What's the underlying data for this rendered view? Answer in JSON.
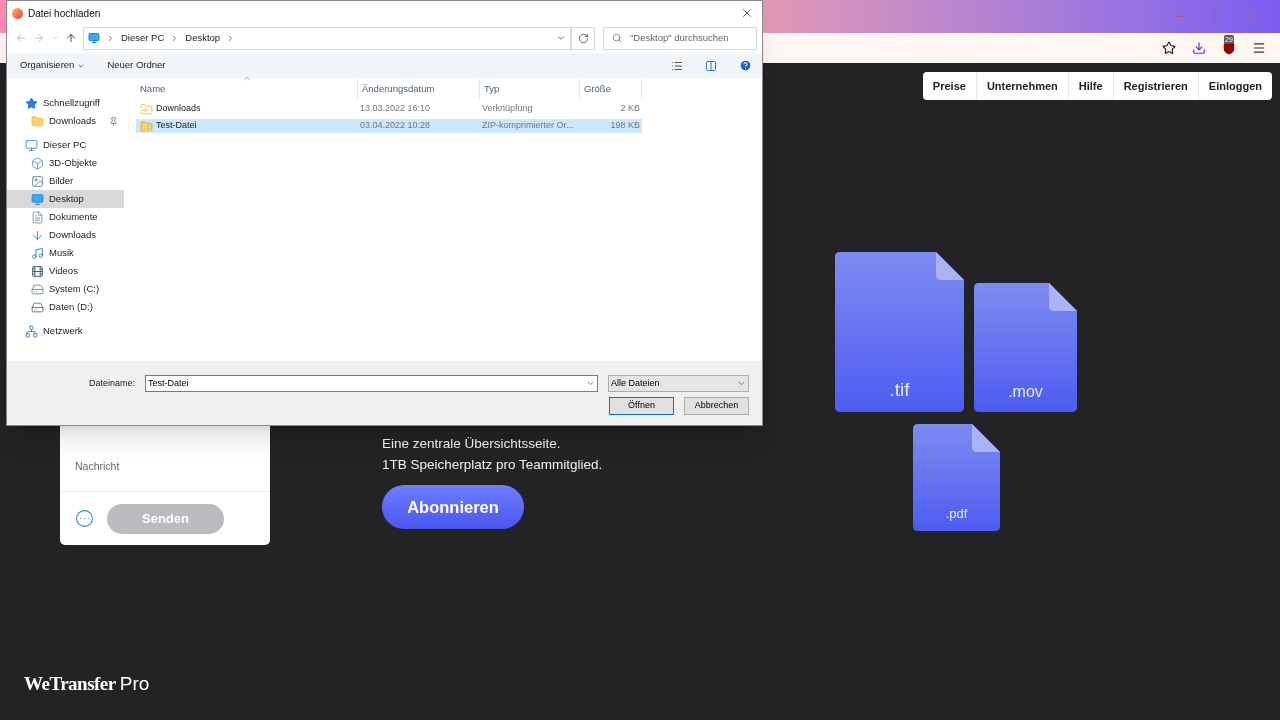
{
  "browser": {
    "badge": "29"
  },
  "nav": [
    "Preise",
    "Unternehmen",
    "Hilfe",
    "Registrieren",
    "Einloggen"
  ],
  "card": {
    "message_placeholder": "Nachricht",
    "send": "Senden"
  },
  "features": [
    "Eine zentrale Übersichtsseite.",
    "1TB Speicherplatz pro Teammitglied."
  ],
  "subscribe": "Abonnieren",
  "files": [
    {
      "ext": ".tif"
    },
    {
      "ext": ".mov"
    },
    {
      "ext": ".pdf"
    }
  ],
  "logo": {
    "brand": "WeTransfer",
    "suffix": "Pro"
  },
  "dialog": {
    "title": "Datei hochladen",
    "breadcrumbs": [
      "Dieser PC",
      "Desktop"
    ],
    "search": {
      "placeholder": "\"Desktop\" durchsuchen"
    },
    "toolbar": [
      "Organisieren",
      "Neuer Ordner"
    ],
    "tree": [
      {
        "label": "Schnellzugriff",
        "kind": "star",
        "selected": false,
        "children": [
          {
            "label": "Downloads",
            "kind": "folder",
            "selected": false,
            "pinned": true
          }
        ]
      },
      {
        "label": "Dieser PC",
        "kind": "pc",
        "selected": false,
        "children": [
          {
            "label": "3D-Objekte",
            "kind": "cube",
            "selected": false
          },
          {
            "label": "Bilder",
            "kind": "image",
            "selected": false
          },
          {
            "label": "Desktop",
            "kind": "desktop",
            "selected": true
          },
          {
            "label": "Dokumente",
            "kind": "document",
            "selected": false
          },
          {
            "label": "Downloads",
            "kind": "download",
            "selected": false
          },
          {
            "label": "Musik",
            "kind": "music",
            "selected": false
          },
          {
            "label": "Videos",
            "kind": "video",
            "selected": false
          },
          {
            "label": "System (C:)",
            "kind": "system",
            "selected": false
          },
          {
            "label": "Daten (D:)",
            "kind": "drive",
            "selected": false
          }
        ]
      },
      {
        "label": "Netzwerk",
        "kind": "network",
        "selected": false
      }
    ],
    "columns": [
      {
        "label": "Name",
        "sorted": true
      },
      {
        "label": "Änderungsdatum",
        "sorted": false
      },
      {
        "label": "Typ",
        "sorted": false
      },
      {
        "label": "Größe",
        "sorted": false
      }
    ],
    "rows": [
      {
        "kind": "shortcut",
        "name": "Downloads",
        "date": "13.03.2022 16:10",
        "type": "Verknüpfung",
        "size": "2 KB",
        "selected": false
      },
      {
        "kind": "zip",
        "name": "Test-Datei",
        "date": "03.04.2022 10:28",
        "type": "ZIP-komprimierter Or...",
        "size": "198 KB",
        "selected": true
      }
    ],
    "filename_label": "Dateiname:",
    "filename": "Test-Datei",
    "filter": "Alle Dateien",
    "open": "Öffnen",
    "cancel": "Abbrechen"
  }
}
